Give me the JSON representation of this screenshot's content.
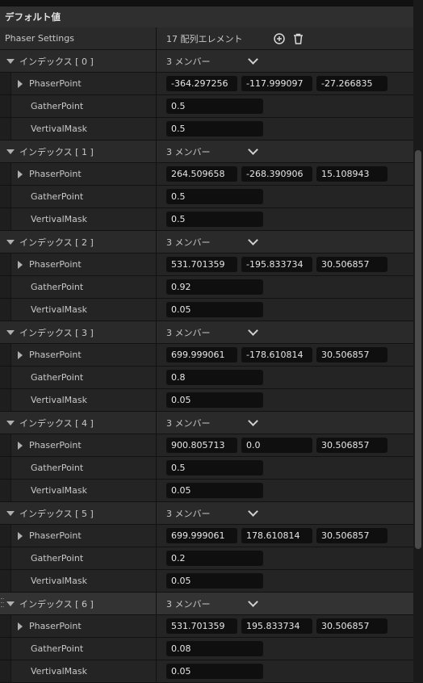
{
  "section": {
    "title": "デフォルト値"
  },
  "array": {
    "label": "Phaser Settings",
    "count_text": "17 配列エレメント",
    "add_icon": "add-circle-icon",
    "delete_icon": "trash-icon"
  },
  "elements": [
    {
      "index_label": "インデックス [ 0 ]",
      "members": "3 メンバー",
      "phaser_label": "PhaserPoint",
      "px": "-364.297256",
      "py": "-117.999097",
      "pz": "-27.266835",
      "gather_label": "GatherPoint",
      "gather": "0.5",
      "mask_label": "VertivalMask",
      "mask": "0.5"
    },
    {
      "index_label": "インデックス [ 1 ]",
      "members": "3 メンバー",
      "phaser_label": "PhaserPoint",
      "px": "264.509658",
      "py": "-268.390906",
      "pz": "15.108943",
      "gather_label": "GatherPoint",
      "gather": "0.5",
      "mask_label": "VertivalMask",
      "mask": "0.5"
    },
    {
      "index_label": "インデックス [ 2 ]",
      "members": "3 メンバー",
      "phaser_label": "PhaserPoint",
      "px": "531.701359",
      "py": "-195.833734",
      "pz": "30.506857",
      "gather_label": "GatherPoint",
      "gather": "0.92",
      "mask_label": "VertivalMask",
      "mask": "0.05"
    },
    {
      "index_label": "インデックス [ 3 ]",
      "members": "3 メンバー",
      "phaser_label": "PhaserPoint",
      "px": "699.999061",
      "py": "-178.610814",
      "pz": "30.506857",
      "gather_label": "GatherPoint",
      "gather": "0.8",
      "mask_label": "VertivalMask",
      "mask": "0.05"
    },
    {
      "index_label": "インデックス [ 4 ]",
      "members": "3 メンバー",
      "phaser_label": "PhaserPoint",
      "px": "900.805713",
      "py": "0.0",
      "pz": "30.506857",
      "gather_label": "GatherPoint",
      "gather": "0.5",
      "mask_label": "VertivalMask",
      "mask": "0.05"
    },
    {
      "index_label": "インデックス [ 5 ]",
      "members": "3 メンバー",
      "phaser_label": "PhaserPoint",
      "px": "699.999061",
      "py": "178.610814",
      "pz": "30.506857",
      "gather_label": "GatherPoint",
      "gather": "0.2",
      "mask_label": "VertivalMask",
      "mask": "0.05"
    },
    {
      "index_label": "インデックス [ 6 ]",
      "members": "3 メンバー",
      "phaser_label": "PhaserPoint",
      "px": "531.701359",
      "py": "195.833734",
      "pz": "30.506857",
      "gather_label": "GatherPoint",
      "gather": "0.08",
      "mask_label": "VertivalMask",
      "mask": "0.05"
    }
  ]
}
